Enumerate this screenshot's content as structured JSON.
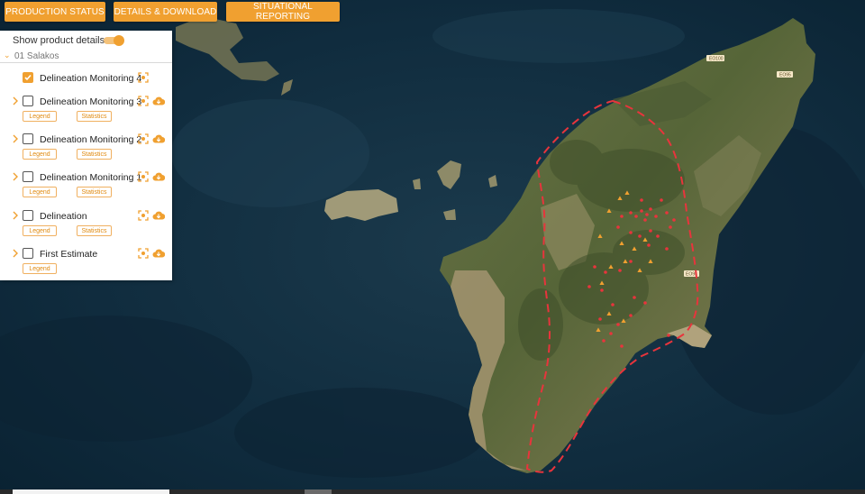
{
  "toolbar": {
    "production_status": "PRODUCTION STATUS",
    "details_download": "DETAILS & DOWNLOAD",
    "situational_reporting": "SITUATIONAL REPORTING"
  },
  "panel": {
    "show_details_label": "Show product details",
    "show_details_on": true,
    "group_label": "01 Salakos",
    "items": [
      {
        "label": "Delineation Monitoring 4",
        "checked": true
      },
      {
        "label": "Delineation Monitoring 3",
        "checked": false,
        "legend": "Legend",
        "statistics": "Statistics"
      },
      {
        "label": "Delineation Monitoring 2",
        "checked": false,
        "legend": "Legend",
        "statistics": "Statistics"
      },
      {
        "label": "Delineation Monitoring 1",
        "checked": false,
        "legend": "Legend",
        "statistics": "Statistics"
      },
      {
        "label": "Delineation",
        "checked": false,
        "legend": "Legend",
        "statistics": "Statistics"
      },
      {
        "label": "First Estimate",
        "checked": false,
        "legend": "Legend"
      }
    ]
  },
  "map": {
    "road_labels": [
      "ΕΟ100",
      "ΕΟ95",
      "ΕΟ95"
    ],
    "colors": {
      "sea": "#0f2d40",
      "land": "#5b6a40",
      "boundary": "#e8343c",
      "accent": "#f0a030"
    }
  }
}
